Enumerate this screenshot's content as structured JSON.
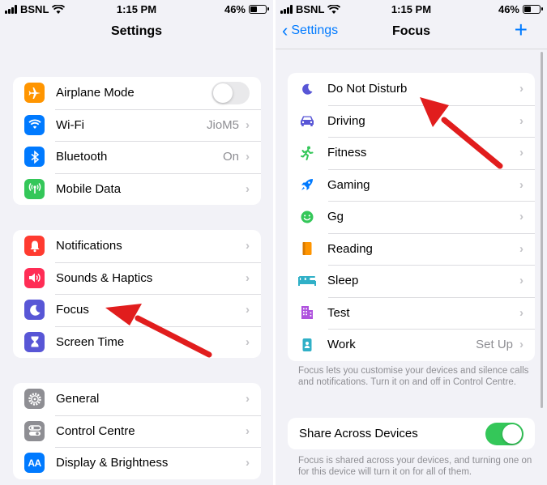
{
  "status_bar": {
    "carrier": "BSNL",
    "time": "1:15 PM",
    "battery": "46%"
  },
  "left": {
    "title": "Settings",
    "groups": [
      {
        "rows": [
          {
            "label": "Airplane Mode",
            "value": "",
            "icon": "airplane-icon",
            "color": "#ff9500",
            "toggle": "off"
          },
          {
            "label": "Wi-Fi",
            "value": "JioM5",
            "icon": "wifi-icon",
            "color": "#007aff"
          },
          {
            "label": "Bluetooth",
            "value": "On",
            "icon": "bluetooth-icon",
            "color": "#007aff"
          },
          {
            "label": "Mobile Data",
            "value": "",
            "icon": "antenna-icon",
            "color": "#34c759"
          }
        ]
      },
      {
        "rows": [
          {
            "label": "Notifications",
            "value": "",
            "icon": "bell-icon",
            "color": "#ff3b30"
          },
          {
            "label": "Sounds & Haptics",
            "value": "",
            "icon": "speaker-icon",
            "color": "#ff2d55"
          },
          {
            "label": "Focus",
            "value": "",
            "icon": "moon-icon",
            "color": "#5856d6"
          },
          {
            "label": "Screen Time",
            "value": "",
            "icon": "hourglass-icon",
            "color": "#5856d6"
          }
        ]
      },
      {
        "rows": [
          {
            "label": "General",
            "value": "",
            "icon": "gear-icon",
            "color": "#8e8e93"
          },
          {
            "label": "Control Centre",
            "value": "",
            "icon": "toggles-icon",
            "color": "#8e8e93"
          },
          {
            "label": "Display & Brightness",
            "value": "",
            "icon": "text-size-icon",
            "color": "#007aff"
          }
        ]
      }
    ]
  },
  "right": {
    "back_label": "Settings",
    "title": "Focus",
    "items": [
      {
        "label": "Do Not Disturb",
        "value": "",
        "icon": "moon-icon",
        "color": "#5856d6"
      },
      {
        "label": "Driving",
        "value": "",
        "icon": "car-icon",
        "color": "#5856d6"
      },
      {
        "label": "Fitness",
        "value": "",
        "icon": "running-icon",
        "color": "#34c759"
      },
      {
        "label": "Gaming",
        "value": "",
        "icon": "rocket-icon",
        "color": "#007aff"
      },
      {
        "label": "Gg",
        "value": "",
        "icon": "smiley-icon",
        "color": "#34c759"
      },
      {
        "label": "Reading",
        "value": "",
        "icon": "book-icon",
        "color": "#ff9500"
      },
      {
        "label": "Sleep",
        "value": "",
        "icon": "bed-icon",
        "color": "#30b0c7"
      },
      {
        "label": "Test",
        "value": "",
        "icon": "building-icon",
        "color": "#af52de"
      },
      {
        "label": "Work",
        "value": "Set Up",
        "icon": "badge-icon",
        "color": "#30b0c7"
      }
    ],
    "focus_footnote": "Focus lets you customise your devices and silence calls and notifications. Turn it on and off in Control Centre.",
    "share_label": "Share Across Devices",
    "share_toggle": "on",
    "share_footnote": "Focus is shared across your devices, and turning one on for this device will turn it on for all of them."
  }
}
